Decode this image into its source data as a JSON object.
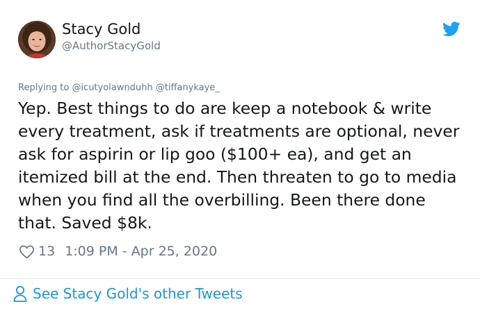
{
  "author": {
    "name": "Stacy Gold",
    "handle": "@AuthorStacyGold",
    "avatar_icon": "avatar-photo",
    "brand_icon": "twitter-bird-icon",
    "brand_color": "#1da1f2"
  },
  "reply": {
    "prefix": "Replying to",
    "mentions": [
      "@icutyolawnduhh",
      "@tiffanykaye_"
    ]
  },
  "tweet": {
    "text": "Yep. Best things to do are keep a notebook & write every treatment, ask if treatments are optional, never ask for aspirin or lip goo ($100+ ea), and get an itemized bill at the end. Then threaten to go to media when you find all the overbilling. Been there done that. Saved $8k."
  },
  "meta": {
    "likes": "13",
    "timestamp": "1:09 PM - Apr 25, 2020",
    "like_icon": "heart-outline-icon"
  },
  "footer": {
    "label": "See Stacy Gold's other Tweets",
    "icon": "person-outline-icon",
    "link_color": "#1b95e0"
  }
}
